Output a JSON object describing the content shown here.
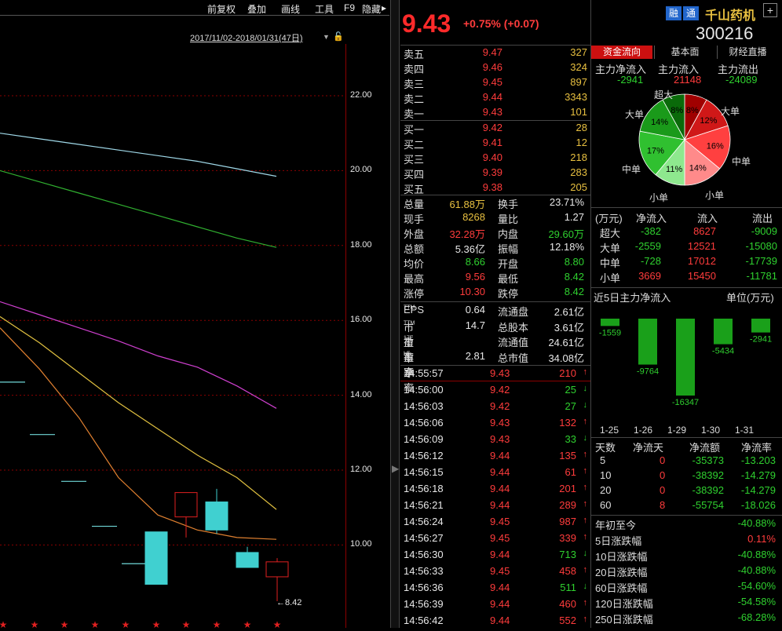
{
  "toolbar": {
    "items": [
      "前复权",
      "叠加",
      "画线",
      "工具",
      "F9",
      "隐藏"
    ],
    "arrow": "▸"
  },
  "chart": {
    "date_range": "2017/11/02-2018/01/31(47日)",
    "y_ticks": [
      "22.00",
      "20.00",
      "18.00",
      "16.00",
      "14.00",
      "12.00",
      "10.00"
    ],
    "low_label": "8.42"
  },
  "chart_data": {
    "type": "candlestick",
    "ylim": [
      8.2,
      23.8
    ],
    "y_ticks": [
      22,
      20,
      18,
      16,
      14,
      12,
      10
    ],
    "candles": [
      {
        "o": 10.35,
        "c": 8.95,
        "h": 10.35,
        "l": 8.95
      },
      {
        "o": 10.75,
        "c": 11.4,
        "h": 11.4,
        "l": 10.2
      },
      {
        "o": 11.15,
        "c": 10.4,
        "h": 11.5,
        "l": 10.3
      },
      {
        "o": 9.8,
        "c": 9.4,
        "h": 9.95,
        "l": 9.4
      },
      {
        "o": 9.15,
        "c": 9.55,
        "h": 9.65,
        "l": 8.5
      }
    ],
    "dashes": [
      14.35,
      12.95,
      11.7,
      10.5,
      9.5
    ],
    "low": 8.42,
    "ma_lines": [
      {
        "color": "#9fd8e8",
        "values": [
          21.0,
          20.85,
          20.7,
          20.55,
          20.4,
          20.25,
          20.05,
          19.85
        ]
      },
      {
        "color": "#30b030",
        "values": [
          20.0,
          19.7,
          19.4,
          19.1,
          18.8,
          18.5,
          18.2,
          17.95
        ]
      },
      {
        "color": "#d040d0",
        "values": [
          16.5,
          16.15,
          15.8,
          15.45,
          15.05,
          14.75,
          14.25,
          13.65
        ]
      },
      {
        "color": "#e0c040",
        "values": [
          16.1,
          15.4,
          14.6,
          13.8,
          13.1,
          12.4,
          11.8,
          10.95
        ]
      },
      {
        "color": "#e08030",
        "values": [
          15.8,
          14.7,
          13.4,
          11.8,
          10.8,
          10.4,
          10.2,
          10.15
        ]
      }
    ]
  },
  "quote": {
    "price": "9.43",
    "change": "+0.75% (+0.07)",
    "badges": [
      "融",
      "通"
    ],
    "name": "千山药机",
    "code": "300216",
    "plus": "+"
  },
  "orderbook": {
    "sell": [
      {
        "label": "卖五",
        "price": "9.47",
        "vol": "327"
      },
      {
        "label": "卖四",
        "price": "9.46",
        "vol": "324"
      },
      {
        "label": "卖三",
        "price": "9.45",
        "vol": "897"
      },
      {
        "label": "卖二",
        "price": "9.44",
        "vol": "3343"
      },
      {
        "label": "卖一",
        "price": "9.43",
        "vol": "101"
      }
    ],
    "buy": [
      {
        "label": "买一",
        "price": "9.42",
        "vol": "28"
      },
      {
        "label": "买二",
        "price": "9.41",
        "vol": "12"
      },
      {
        "label": "买三",
        "price": "9.40",
        "vol": "218"
      },
      {
        "label": "买四",
        "price": "9.39",
        "vol": "283"
      },
      {
        "label": "买五",
        "price": "9.38",
        "vol": "205"
      }
    ]
  },
  "stats": [
    [
      "总量",
      "61.88万",
      "yel",
      "换手",
      "23.71%",
      "wht"
    ],
    [
      "现手",
      "8268",
      "yel",
      "量比",
      "1.27",
      "wht"
    ],
    [
      "外盘",
      "32.28万",
      "red",
      "内盘",
      "29.60万",
      "grn"
    ],
    [
      "总额",
      "5.36亿",
      "wht",
      "振幅",
      "12.18%",
      "wht"
    ],
    [
      "均价",
      "8.66",
      "grn",
      "开盘",
      "8.80",
      "grn"
    ],
    [
      "最高",
      "9.56",
      "red",
      "最低",
      "8.42",
      "grn"
    ],
    [
      "涨停",
      "10.30",
      "red",
      "跌停",
      "8.42",
      "grn"
    ]
  ],
  "fundamentals": [
    [
      "EPS",
      "TTM",
      "0.64",
      "流通盘",
      "2.61亿"
    ],
    [
      "市盈率",
      "TTM",
      "14.7",
      "总股本",
      "3.61亿"
    ],
    [
      "市盈率",
      "17E",
      "",
      "流通值",
      "24.61亿"
    ],
    [
      "市净率",
      "LF",
      "2.81",
      "总市值",
      "34.08亿"
    ]
  ],
  "ticks": [
    [
      "14:55:57",
      "9.43",
      "210",
      "↑",
      "red",
      "red"
    ],
    [
      "14:56:00",
      "9.42",
      "25",
      "↓",
      "red",
      "grn"
    ],
    [
      "14:56:03",
      "9.42",
      "27",
      "↓",
      "red",
      "grn"
    ],
    [
      "14:56:06",
      "9.43",
      "132",
      "↑",
      "red",
      "red"
    ],
    [
      "14:56:09",
      "9.43",
      "33",
      "↓",
      "red",
      "grn"
    ],
    [
      "14:56:12",
      "9.44",
      "135",
      "↑",
      "red",
      "red"
    ],
    [
      "14:56:15",
      "9.44",
      "61",
      "↑",
      "red",
      "red"
    ],
    [
      "14:56:18",
      "9.44",
      "201",
      "↑",
      "red",
      "red"
    ],
    [
      "14:56:21",
      "9.44",
      "289",
      "↑",
      "red",
      "red"
    ],
    [
      "14:56:24",
      "9.45",
      "987",
      "↑",
      "red",
      "red"
    ],
    [
      "14:56:27",
      "9.45",
      "339",
      "↑",
      "red",
      "red"
    ],
    [
      "14:56:30",
      "9.44",
      "713",
      "↓",
      "red",
      "grn"
    ],
    [
      "14:56:33",
      "9.45",
      "458",
      "↑",
      "red",
      "red"
    ],
    [
      "14:56:36",
      "9.44",
      "511",
      "↓",
      "red",
      "grn"
    ],
    [
      "14:56:39",
      "9.44",
      "460",
      "↑",
      "red",
      "red"
    ],
    [
      "14:56:42",
      "9.44",
      "552",
      "↑",
      "red",
      "red"
    ]
  ],
  "flow": {
    "tabs": [
      "资金流向",
      "基本面",
      "财经直播"
    ],
    "heads": [
      "主力净流入",
      "主力流入",
      "主力流出"
    ],
    "vals": [
      "-2941",
      "21148",
      "-24089"
    ],
    "pie_labels": {
      "top": "超大",
      "tl": "大单",
      "tr": "大单",
      "ml": "中单",
      "mr": "中单",
      "bl": "小单",
      "br": "小单"
    },
    "pie": [
      {
        "label": "超大",
        "pct": "8%",
        "value": 8,
        "color": "#a00000"
      },
      {
        "label": "大单",
        "pct": "12%",
        "value": 12,
        "color": "#d01818"
      },
      {
        "label": "中单",
        "pct": "16%",
        "value": 16,
        "color": "#ff4040"
      },
      {
        "label": "小单",
        "pct": "14%",
        "value": 14,
        "color": "#ff8a8a"
      },
      {
        "label": "小单",
        "pct": "11%",
        "value": 11,
        "color": "#8ee88e"
      },
      {
        "label": "中单",
        "pct": "17%",
        "value": 17,
        "color": "#30c030"
      },
      {
        "label": "大单",
        "pct": "14%",
        "value": 14,
        "color": "#1a9a1a"
      },
      {
        "label": "超大",
        "pct": "8%",
        "value": 8,
        "color": "#0a6a0a"
      }
    ],
    "table_head": [
      "(万元)",
      "净流入",
      "流入",
      "流出"
    ],
    "table": [
      [
        "超大",
        "-382",
        "8627",
        "-9009"
      ],
      [
        "大单",
        "-2559",
        "12521",
        "-15080"
      ],
      [
        "中单",
        "-728",
        "17012",
        "-17739"
      ],
      [
        "小单",
        "3669",
        "15450",
        "-11781"
      ]
    ],
    "five_title": "近5日主力净流入",
    "five_unit": "单位(万元)",
    "five": [
      {
        "d": "1-25",
        "v": -1559
      },
      {
        "d": "1-26",
        "v": -9764
      },
      {
        "d": "1-29",
        "v": -16347
      },
      {
        "d": "1-30",
        "v": -5434
      },
      {
        "d": "1-31",
        "v": -2941
      }
    ],
    "days_head": [
      "天数",
      "净流天",
      "净流额",
      "净流率"
    ],
    "days": [
      [
        "5",
        "0",
        "-35373",
        "-13.203"
      ],
      [
        "10",
        "0",
        "-38392",
        "-14.279"
      ],
      [
        "20",
        "0",
        "-38392",
        "-14.279"
      ],
      [
        "60",
        "8",
        "-55754",
        "-18.026"
      ]
    ],
    "perf": [
      [
        "年初至今",
        "-40.88%",
        "grn"
      ],
      [
        "5日涨跌幅",
        "0.11%",
        "red"
      ],
      [
        "10日涨跌幅",
        "-40.88%",
        "grn"
      ],
      [
        "20日涨跌幅",
        "-40.88%",
        "grn"
      ],
      [
        "60日涨跌幅",
        "-54.60%",
        "grn"
      ],
      [
        "120日涨跌幅",
        "-54.58%",
        "grn"
      ],
      [
        "250日涨跌幅",
        "-68.28%",
        "grn"
      ]
    ]
  }
}
